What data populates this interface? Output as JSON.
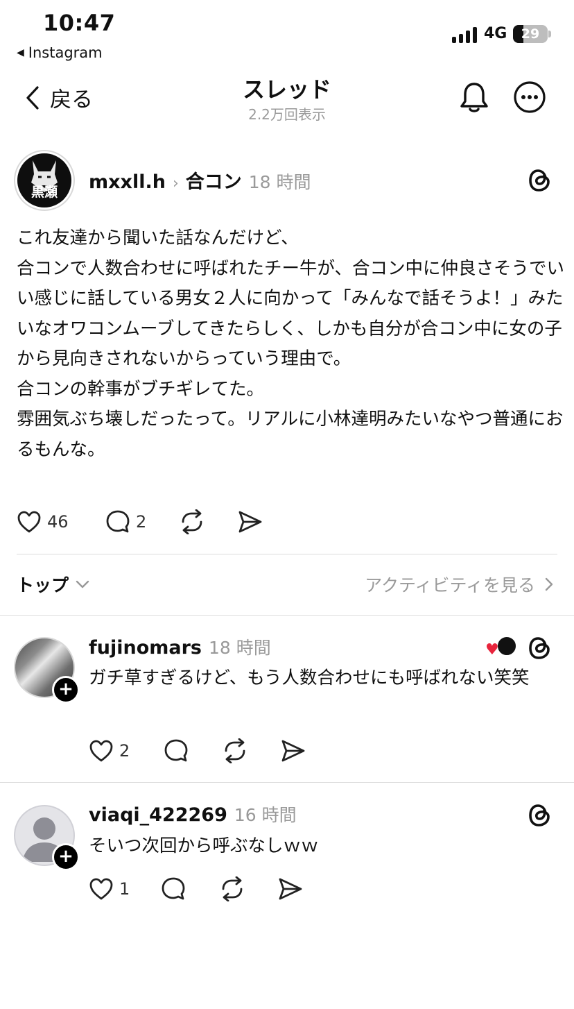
{
  "status_bar": {
    "time": "10:47",
    "back_app": "Instagram",
    "network": "4G",
    "battery": "29",
    "battery_level": 0.29
  },
  "nav": {
    "back_label": "戻る",
    "title": "スレッド",
    "subtitle": "2.2万回表示"
  },
  "post": {
    "avatar_text": "黒瀬",
    "username": "mxxll.h",
    "tag": "合コン",
    "time": "18 時間",
    "body": "これ友達から聞いた話なんだけど、\n合コンで人数合わせに呼ばれたチー牛が、合コン中に仲良さそうでいい感じに話している男女２人に向かって「みんなで話そうよ！」みたいなオワコンムーブしてきたらしく、しかも自分が合コン中に女の子から見向きされないからっていう理由で。\n合コンの幹事がブチギレてた。\n雰囲気ぶち壊しだったって。リアルに小林達明みたいなやつ普通におるもんな。",
    "likes": "46",
    "replies": "2"
  },
  "filter": {
    "sort_label": "トップ",
    "activity_label": "アクティビティを見る"
  },
  "comments": [
    {
      "username": "fujinomars",
      "time": "18 時間",
      "text": "ガチ草すぎるけど、もう人数合わせにも呼ばれない笑笑",
      "likes": "2"
    },
    {
      "username": "viaqi_422269",
      "time": "16 時間",
      "text": "そいつ次回から呼ぶなしｗｗ",
      "likes": "1"
    }
  ],
  "colors": {
    "secondary_text": "#999999",
    "divider": "#dcdcdc",
    "like_heart": "#e8243c"
  }
}
